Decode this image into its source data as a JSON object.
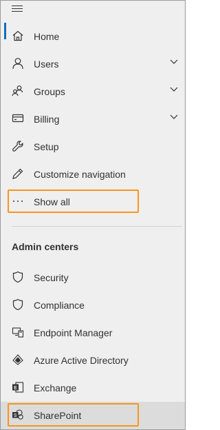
{
  "nav": {
    "items": [
      {
        "label": "Home",
        "icon": "home-icon"
      },
      {
        "label": "Users",
        "icon": "user-icon",
        "expandable": true
      },
      {
        "label": "Groups",
        "icon": "groups-icon",
        "expandable": true
      },
      {
        "label": "Billing",
        "icon": "billing-card-icon",
        "expandable": true
      },
      {
        "label": "Setup",
        "icon": "wrench-icon"
      },
      {
        "label": "Customize navigation",
        "icon": "pencil-icon"
      },
      {
        "label": "Show all",
        "icon": "ellipsis-icon"
      }
    ]
  },
  "admin_centers": {
    "title": "Admin centers",
    "items": [
      {
        "label": "Security",
        "icon": "shield-icon"
      },
      {
        "label": "Compliance",
        "icon": "shield-outline-icon"
      },
      {
        "label": "Endpoint Manager",
        "icon": "endpoint-manager-icon"
      },
      {
        "label": "Azure Active Directory",
        "icon": "azure-ad-icon"
      },
      {
        "label": "Exchange",
        "icon": "exchange-icon"
      },
      {
        "label": "SharePoint",
        "icon": "sharepoint-icon"
      }
    ]
  },
  "colors": {
    "active_indicator": "#0f6cbd",
    "highlight_border": "#f7941d",
    "text": "#323130",
    "background": "#efefef"
  }
}
